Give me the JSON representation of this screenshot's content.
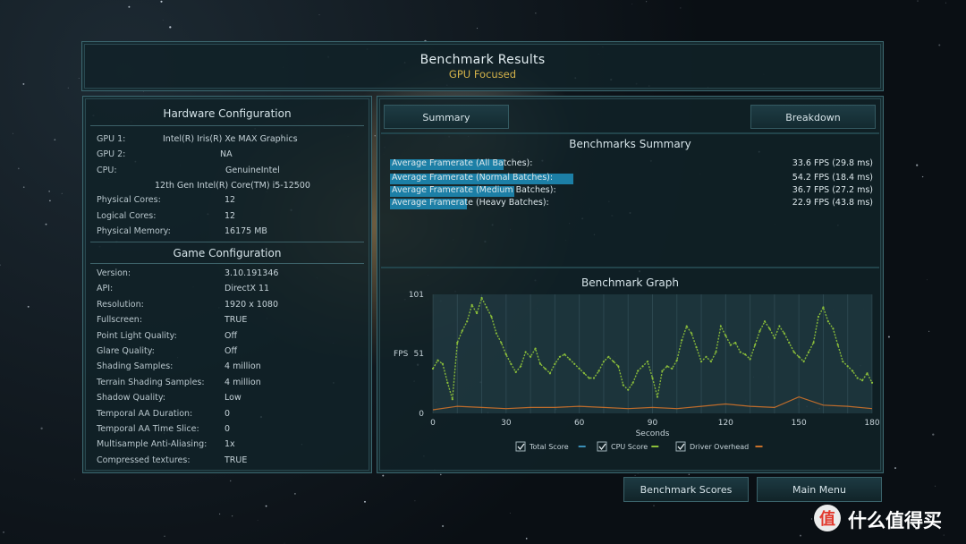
{
  "header": {
    "title": "Benchmark Results",
    "subtitle": "GPU Focused"
  },
  "hardware": {
    "title": "Hardware Configuration",
    "rows": [
      {
        "label": "GPU 1:",
        "value": "Intel(R) Iris(R) Xe MAX Graphics"
      },
      {
        "label": "GPU 2:",
        "value": "NA"
      },
      {
        "label": "CPU:",
        "value": "GenuineIntel"
      },
      {
        "label": "",
        "value": "12th Gen Intel(R) Core(TM) i5-12500"
      },
      {
        "label": "Physical Cores:",
        "value": "12"
      },
      {
        "label": "Logical Cores:",
        "value": "12"
      },
      {
        "label": "Physical Memory:",
        "value": "16175  MB"
      }
    ]
  },
  "game": {
    "title": "Game Configuration",
    "rows": [
      {
        "label": "Version:",
        "value": "3.10.191346"
      },
      {
        "label": "API:",
        "value": "DirectX 11"
      },
      {
        "label": "Resolution:",
        "value": "1920 x 1080"
      },
      {
        "label": "Fullscreen:",
        "value": "TRUE"
      },
      {
        "label": "Point Light Quality:",
        "value": "Off"
      },
      {
        "label": "Glare Quality:",
        "value": "Off"
      },
      {
        "label": "Shading Samples:",
        "value": "4 million"
      },
      {
        "label": "Terrain Shading Samples:",
        "value": "4 million"
      },
      {
        "label": "Shadow Quality:",
        "value": "Low"
      },
      {
        "label": "Temporal AA Duration:",
        "value": "0"
      },
      {
        "label": "Temporal AA Time Slice:",
        "value": "0"
      },
      {
        "label": "Multisample Anti-Aliasing:",
        "value": "1x"
      },
      {
        "label": "Compressed textures:",
        "value": "TRUE"
      }
    ]
  },
  "tabs": {
    "summary": "Summary",
    "breakdown": "Breakdown"
  },
  "summary": {
    "title": "Benchmarks Summary",
    "bars": [
      {
        "label": "Average Framerate (All Batches):",
        "value": "33.6 FPS (29.8 ms)",
        "fps": 33.6
      },
      {
        "label": "Average Framerate (Normal Batches):",
        "value": "54.2 FPS (18.4 ms)",
        "fps": 54.2
      },
      {
        "label": "Average Framerate (Medium Batches):",
        "value": "36.7 FPS (27.2 ms)",
        "fps": 36.7
      },
      {
        "label": "Average Framerate (Heavy Batches):",
        "value": "22.9 FPS (43.8 ms)",
        "fps": 22.9
      }
    ],
    "bar_max_fps": 143
  },
  "graph_title": "Benchmark Graph",
  "chart_data": {
    "type": "line",
    "xlabel": "Seconds",
    "ylabel": "FPS",
    "xlim": [
      0,
      180
    ],
    "ylim": [
      0,
      101
    ],
    "x_ticks": [
      "0",
      "30",
      "60",
      "90",
      "120",
      "150",
      "180"
    ],
    "y_ticks": [
      "0",
      "51",
      "101"
    ],
    "legend": [
      "Total Score",
      "CPU Score",
      "Driver Overhead"
    ],
    "legend_placement": "bottom",
    "series": [
      {
        "name": "CPU Score",
        "color": "#8bbf3a",
        "x": [
          0,
          2,
          4,
          6,
          8,
          10,
          12,
          14,
          16,
          18,
          20,
          22,
          24,
          26,
          28,
          30,
          32,
          34,
          36,
          38,
          40,
          42,
          44,
          46,
          48,
          50,
          52,
          54,
          56,
          58,
          60,
          62,
          64,
          66,
          68,
          70,
          72,
          74,
          76,
          78,
          80,
          82,
          84,
          86,
          88,
          90,
          92,
          94,
          96,
          98,
          100,
          102,
          104,
          106,
          108,
          110,
          112,
          114,
          116,
          118,
          120,
          122,
          124,
          126,
          128,
          130,
          132,
          134,
          136,
          138,
          140,
          142,
          144,
          146,
          148,
          150,
          152,
          154,
          156,
          158,
          160,
          162,
          164,
          166,
          168,
          170,
          172,
          174,
          176,
          178,
          180
        ],
        "y": [
          38,
          45,
          42,
          26,
          12,
          60,
          70,
          78,
          92,
          85,
          98,
          90,
          82,
          68,
          60,
          50,
          42,
          35,
          40,
          52,
          48,
          55,
          42,
          38,
          34,
          42,
          48,
          50,
          46,
          42,
          38,
          34,
          30,
          30,
          36,
          44,
          48,
          44,
          40,
          24,
          20,
          26,
          36,
          40,
          44,
          30,
          14,
          36,
          40,
          38,
          45,
          62,
          74,
          68,
          56,
          44,
          48,
          44,
          52,
          74,
          66,
          58,
          60,
          52,
          50,
          46,
          58,
          70,
          78,
          72,
          64,
          74,
          68,
          60,
          52,
          48,
          44,
          52,
          60,
          82,
          90,
          78,
          72,
          58,
          44,
          40,
          36,
          30,
          28,
          34,
          26
        ],
        "_note_ignore": ""
      },
      {
        "name": "Driver Overhead",
        "color": "#c8702a",
        "x": [
          0,
          10,
          20,
          30,
          40,
          50,
          60,
          70,
          80,
          90,
          100,
          110,
          120,
          130,
          140,
          150,
          160,
          170,
          180
        ],
        "y": [
          3,
          6,
          5,
          4,
          5,
          5,
          6,
          5,
          4,
          5,
          4,
          6,
          8,
          6,
          5,
          14,
          7,
          6,
          4
        ]
      },
      {
        "name": "Total Score",
        "color": "#3a8fb8",
        "x": [],
        "y": []
      }
    ]
  },
  "buttons": {
    "scores": "Benchmark Scores",
    "main_menu": "Main Menu"
  },
  "watermark": {
    "text": "什么值得买"
  }
}
